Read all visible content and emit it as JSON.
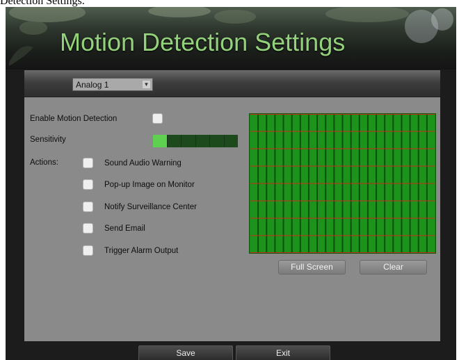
{
  "caption": "Detection Settings.",
  "window": {
    "title": "Motion Detection Settings"
  },
  "camera_select": {
    "value": "Analog 1"
  },
  "enable": {
    "label": "Enable Motion Detection",
    "checked": false
  },
  "sensitivity": {
    "label": "Sensitivity",
    "level": 1,
    "max": 6
  },
  "actions": {
    "label": "Actions:",
    "items": [
      {
        "label": "Sound Audio Warning",
        "checked": false
      },
      {
        "label": "Pop-up Image on Monitor",
        "checked": false
      },
      {
        "label": "Notify Surveillance Center",
        "checked": false
      },
      {
        "label": "Send Email",
        "checked": false
      },
      {
        "label": "Trigger Alarm Output",
        "checked": false
      }
    ]
  },
  "motion_grid": {
    "columns": 22,
    "rows": 8,
    "fill_color": "#1c941c",
    "line_color": "#cc2a1e"
  },
  "grid_buttons": {
    "full_screen": "Full Screen",
    "clear": "Clear"
  },
  "footer": {
    "save": "Save",
    "exit": "Exit"
  },
  "colors": {
    "title": "#93d27a",
    "panel": "#8a8a8a",
    "sensitivity_on": "#5ed150"
  }
}
